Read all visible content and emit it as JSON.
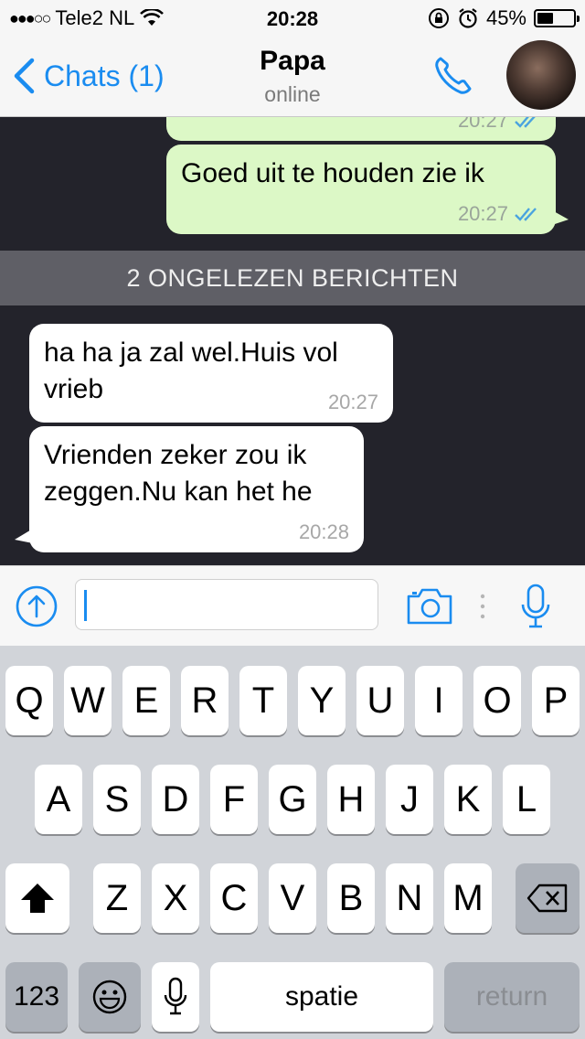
{
  "status_bar": {
    "signal": "●●●○○",
    "carrier": "Tele2 NL",
    "time": "20:28",
    "battery_percent": "45%",
    "battery_level": 0.45,
    "icons": [
      "wifi-icon",
      "orientation-lock-icon",
      "alarm-icon",
      "battery-icon"
    ]
  },
  "nav": {
    "back_label": "Chats (1)",
    "contact_name": "Papa",
    "contact_status": "online",
    "icons": [
      "chevron-left-icon",
      "phone-icon",
      "avatar"
    ]
  },
  "chat": {
    "messages": [
      {
        "direction": "out",
        "text": "",
        "time": "20:27",
        "ticks": "read"
      },
      {
        "direction": "out",
        "text": "Goed uit te houden zie ik",
        "time": "20:27",
        "ticks": "read"
      },
      {
        "direction": "in",
        "text": "ha ha ja zal wel.Huis vol vrieb",
        "time": "20:27"
      },
      {
        "direction": "in",
        "text": "Vrienden zeker zou ik zeggen.Nu kan het he",
        "time": "20:28"
      }
    ],
    "unread_divider": "2 ONGELEZEN BERICHTEN"
  },
  "input_bar": {
    "value": "",
    "icons": [
      "share-icon",
      "camera-icon",
      "more-dots-icon",
      "microphone-icon"
    ]
  },
  "keyboard": {
    "row1": [
      "Q",
      "W",
      "E",
      "R",
      "T",
      "Y",
      "U",
      "I",
      "O",
      "P"
    ],
    "row2": [
      "A",
      "S",
      "D",
      "F",
      "G",
      "H",
      "J",
      "K",
      "L"
    ],
    "row3": [
      "Z",
      "X",
      "C",
      "V",
      "B",
      "N",
      "M"
    ],
    "numbers_label": "123",
    "space_label": "spatie",
    "return_label": "return",
    "icons": [
      "shift-icon",
      "backspace-icon",
      "emoji-icon",
      "dictation-mic-icon"
    ]
  },
  "colors": {
    "accent": "#1a8cf0",
    "outgoing_bubble": "#dcf8c6",
    "incoming_bubble": "#ffffff",
    "chat_background": "#23232b",
    "unread_divider": "#5f5f66",
    "read_ticks": "#4aa3df"
  }
}
